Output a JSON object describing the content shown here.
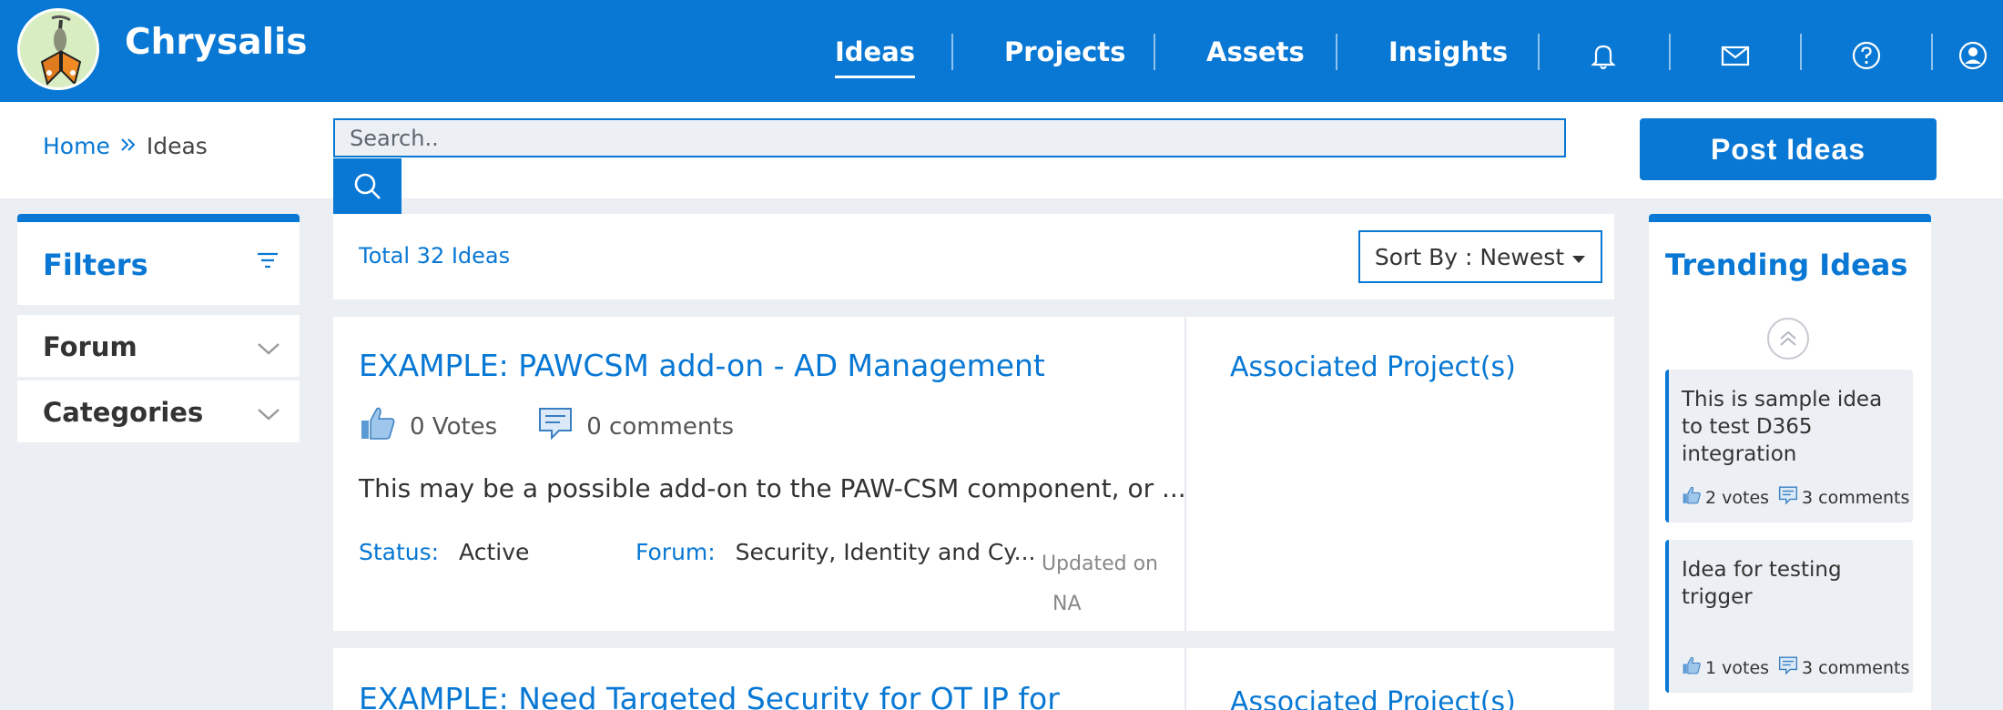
{
  "app": {
    "name": "Chrysalis"
  },
  "nav": {
    "items": [
      {
        "label": "Ideas"
      },
      {
        "label": "Projects"
      },
      {
        "label": "Assets"
      },
      {
        "label": "Insights"
      }
    ],
    "icons": [
      "bell-icon",
      "mail-icon",
      "help-icon",
      "user-icon"
    ],
    "accent": "#0878d4"
  },
  "breadcrumb": {
    "home": "Home",
    "current": "Ideas"
  },
  "search": {
    "placeholder": "Search.."
  },
  "post_button": "Post Ideas",
  "filters": {
    "title": "Filters",
    "groups": [
      {
        "label": "Forum"
      },
      {
        "label": "Categories"
      }
    ]
  },
  "list": {
    "total": "Total 32 Ideas",
    "sort_label": "Sort By : Newest"
  },
  "ideas": [
    {
      "title": "EXAMPLE: PAWCSM add-on - AD Management",
      "votes": "0 Votes",
      "comments": "0 comments",
      "description": "This may be a possible add-on to the PAW-CSM component, or ...",
      "status_label": "Status:",
      "status": "Active",
      "forum_label": "Forum:",
      "forum": "Security, Identity and Cy...",
      "updated_line1": "Updated on",
      "updated_line2": "NA",
      "associated": "Associated Project(s)"
    },
    {
      "title": "EXAMPLE: Need Targeted Security for OT IP for",
      "associated": "Associated Project(s)"
    }
  ],
  "trending": {
    "title": "Trending Ideas",
    "items": [
      {
        "text": "This is sample idea to test D365 integration",
        "votes": "2 votes",
        "comments": "3 comments"
      },
      {
        "text": "Idea for testing trigger",
        "votes": "1 votes",
        "comments": "3 comments"
      }
    ]
  }
}
